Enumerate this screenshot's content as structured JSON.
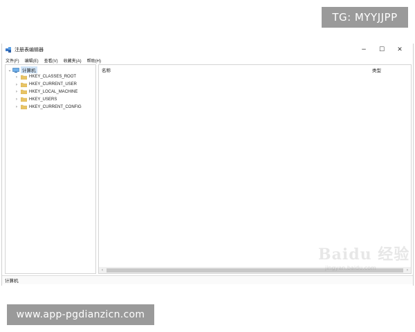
{
  "overlay": {
    "tg_label": "TG: MYYJJPP",
    "url_label": "www.app-pgdianzicn.com"
  },
  "window": {
    "title": "注册表编辑器",
    "controls": {
      "minimize": "−",
      "maximize": "☐",
      "close": "✕"
    }
  },
  "menubar": {
    "items": [
      {
        "label": "文件(F)"
      },
      {
        "label": "编辑(E)"
      },
      {
        "label": "查看(V)"
      },
      {
        "label": "收藏夹(A)"
      },
      {
        "label": "帮助(H)"
      }
    ]
  },
  "tree": {
    "root_label": "计算机",
    "items": [
      {
        "label": "HKEY_CLASSES_ROOT"
      },
      {
        "label": "HKEY_CURRENT_USER"
      },
      {
        "label": "HKEY_LOCAL_MACHINE"
      },
      {
        "label": "HKEY_USERS"
      },
      {
        "label": "HKEY_CURRENT_CONFIG"
      }
    ]
  },
  "list": {
    "columns": {
      "name": "名称",
      "type": "类型"
    }
  },
  "statusbar": {
    "path": "计算机"
  },
  "watermark": {
    "text": "Baidu 经验",
    "sub": "jingyan.baidu.com"
  },
  "colors": {
    "badge_bg": "#9a9a9a",
    "folder": "#e8c466",
    "selection": "#cfe3f7"
  }
}
